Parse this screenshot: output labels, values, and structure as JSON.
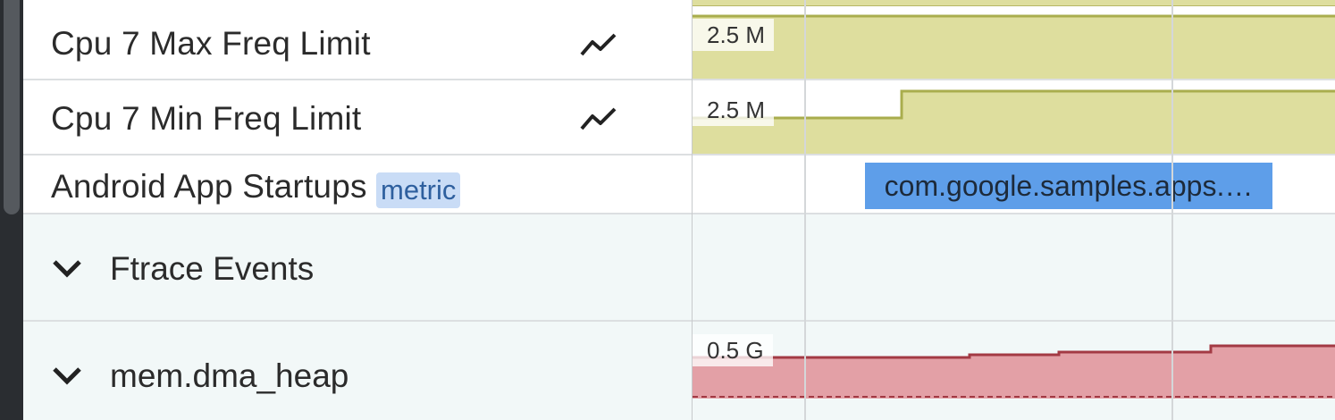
{
  "tracks": [
    {
      "label": "Cpu 7 Max Freq Limit",
      "axis_max": "2.5 M"
    },
    {
      "label": "Cpu 7 Min Freq Limit",
      "axis_max": "2.5 M"
    },
    {
      "label": "Android App Startups",
      "badge": "metric",
      "slice_label": "com.google.samples.apps.…"
    }
  ],
  "groups": [
    {
      "label": "Ftrace Events"
    },
    {
      "label": "mem.dma_heap",
      "axis_max": "0.5 G"
    }
  ],
  "icons": {
    "trend": "line-chart-icon",
    "expand": "chevron-down-icon"
  },
  "colors": {
    "freq_fill": "#dede9e",
    "freq_line": "#a9ad4d",
    "slice": "#5e9ee9",
    "heap_fill": "#e3a0a6",
    "heap_line": "#a33a44",
    "badge_bg": "#c9dcf6",
    "group_bg": "#f2f8f8"
  }
}
